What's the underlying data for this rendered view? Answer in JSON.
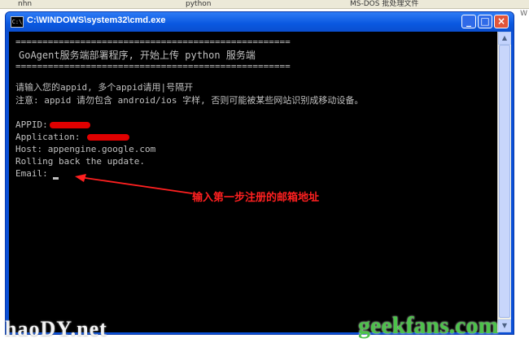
{
  "taskbar": {
    "items": [
      "nhn",
      "python",
      "MS-DOS 批处理文件"
    ],
    "side_label": "W"
  },
  "window": {
    "title": "C:\\WINDOWS\\system32\\cmd.exe",
    "controls": {
      "minimize": "_",
      "maximize": "□",
      "close": "×"
    }
  },
  "console": {
    "separator": "===================================================",
    "heading": "GoAgent服务端部署程序, 开始上传 python 服务端",
    "prompt_appid": "请输入您的appid, 多个appid请用|号隔开",
    "notice": "注意: appid 请勿包含 android/ios 字样, 否则可能被某些网站识别成移动设备。",
    "appid_label": "APPID:",
    "application_label": "Application: ",
    "host_line": "Host: appengine.google.com",
    "rollback_line": "Rolling back the update.",
    "email_label": "Email:"
  },
  "annotation": {
    "text": "输入第一步注册的邮箱地址",
    "color": "#ff2020"
  },
  "watermarks": {
    "left": "haoDY.net",
    "right": "geekfans.com"
  },
  "colors": {
    "title_bar": "#0a58e0",
    "console_bg": "#000000",
    "console_text": "#c0c0c0",
    "close_button": "#e0553a",
    "redaction": "#e00000"
  },
  "icons": [
    "cmd-icon",
    "minimize-icon",
    "maximize-icon",
    "close-icon",
    "scroll-up-icon",
    "scroll-down-icon",
    "arrow-pointer-icon"
  ]
}
